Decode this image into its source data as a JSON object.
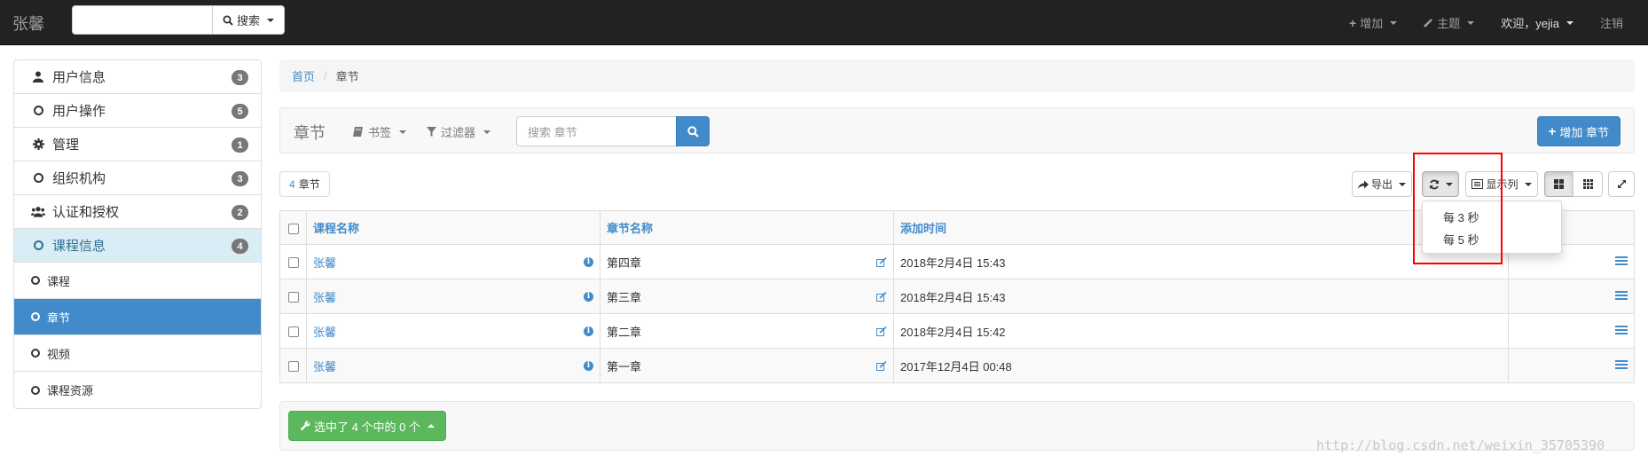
{
  "navbar": {
    "brand": "张馨",
    "search_placeholder": "",
    "search_label": "搜索",
    "add_label": "增加",
    "theme_label": "主题",
    "welcome_label": "欢迎，yejia",
    "logout_label": "注销"
  },
  "sidebar": {
    "items": [
      {
        "label": "用户信息",
        "badge": "3",
        "icon": "user-icon"
      },
      {
        "label": "用户操作",
        "badge": "5",
        "icon": "circle-icon"
      },
      {
        "label": "管理",
        "badge": "1",
        "icon": "gear-icon"
      },
      {
        "label": "组织机构",
        "badge": "3",
        "icon": "circle-icon"
      },
      {
        "label": "认证和授权",
        "badge": "2",
        "icon": "users-icon"
      },
      {
        "label": "课程信息",
        "badge": "4",
        "icon": "circle-icon"
      }
    ],
    "sub_items": [
      "课程",
      "章节",
      "视频",
      "课程资源"
    ]
  },
  "breadcrumb": {
    "home": "首页",
    "current": "章节"
  },
  "panel": {
    "title": "章节",
    "bookmark_label": "书签",
    "filter_label": "过滤器",
    "search_placeholder": "搜索 章节",
    "add_button_label": "增加 章节"
  },
  "toolbar": {
    "count_number": "4",
    "count_unit": "章节",
    "export_label": "导出",
    "columns_label": "显示列"
  },
  "refresh_dropdown": {
    "options": [
      "每 3 秒",
      "每 5 秒"
    ]
  },
  "table": {
    "headers": [
      "课程名称",
      "章节名称",
      "添加时间"
    ],
    "rows": [
      {
        "course": "张馨",
        "chapter": "第四章",
        "time": "2018年2月4日 15:43"
      },
      {
        "course": "张馨",
        "chapter": "第三章",
        "time": "2018年2月4日 15:43"
      },
      {
        "course": "张馨",
        "chapter": "第二章",
        "time": "2018年2月4日 15:42"
      },
      {
        "course": "张馨",
        "chapter": "第一章",
        "time": "2017年12月4日 00:48"
      }
    ]
  },
  "selection_label": "选中了 4 个中的 0 个",
  "watermark": "http://blog.csdn.net/weixin_35705390",
  "colors": {
    "primary": "#428bca",
    "success": "#5cb85c",
    "navbar": "#222222",
    "highlight": "#ff0000"
  }
}
